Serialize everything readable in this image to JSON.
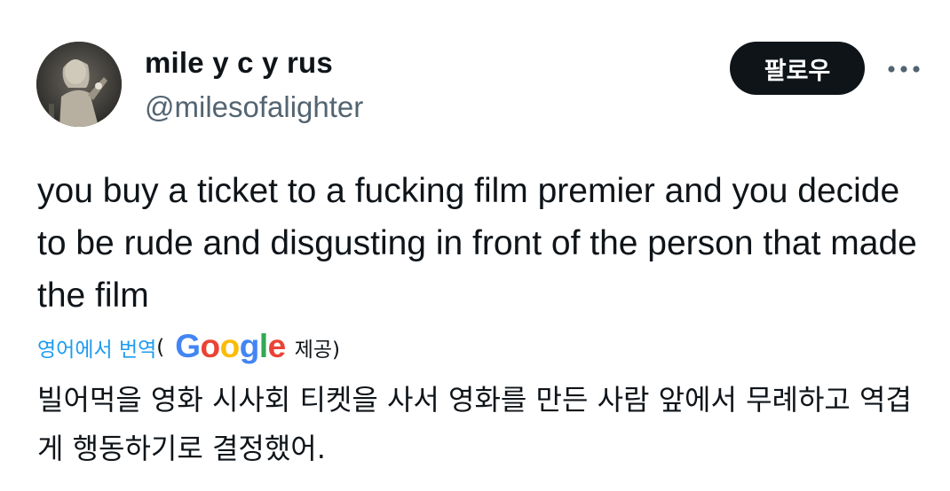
{
  "author": {
    "display_name": "mile y c y rus",
    "handle": "@milesofalighter",
    "avatar_icon": "profile-photo"
  },
  "actions": {
    "follow_label": "팔로우",
    "more_icon": "more-horizontal-icon"
  },
  "tweet": {
    "text": "you buy a ticket to a fucking film premier and you decide to be rude and disgusting in front of the person that made the film"
  },
  "translation": {
    "link_label": "영어에서 번역",
    "paren_open": "(",
    "provider_logo": "Google",
    "provided_label": "제공)",
    "text": "빌어먹을 영화 시사회 티켓을 사서 영화를 만든 사람 앞에서 무례하고 역겹게 행동하기로 결정했어."
  },
  "colors": {
    "link_blue": "#1d9bf0",
    "text_primary": "#0f1419",
    "text_secondary": "#536471",
    "button_bg": "#0f1419"
  }
}
